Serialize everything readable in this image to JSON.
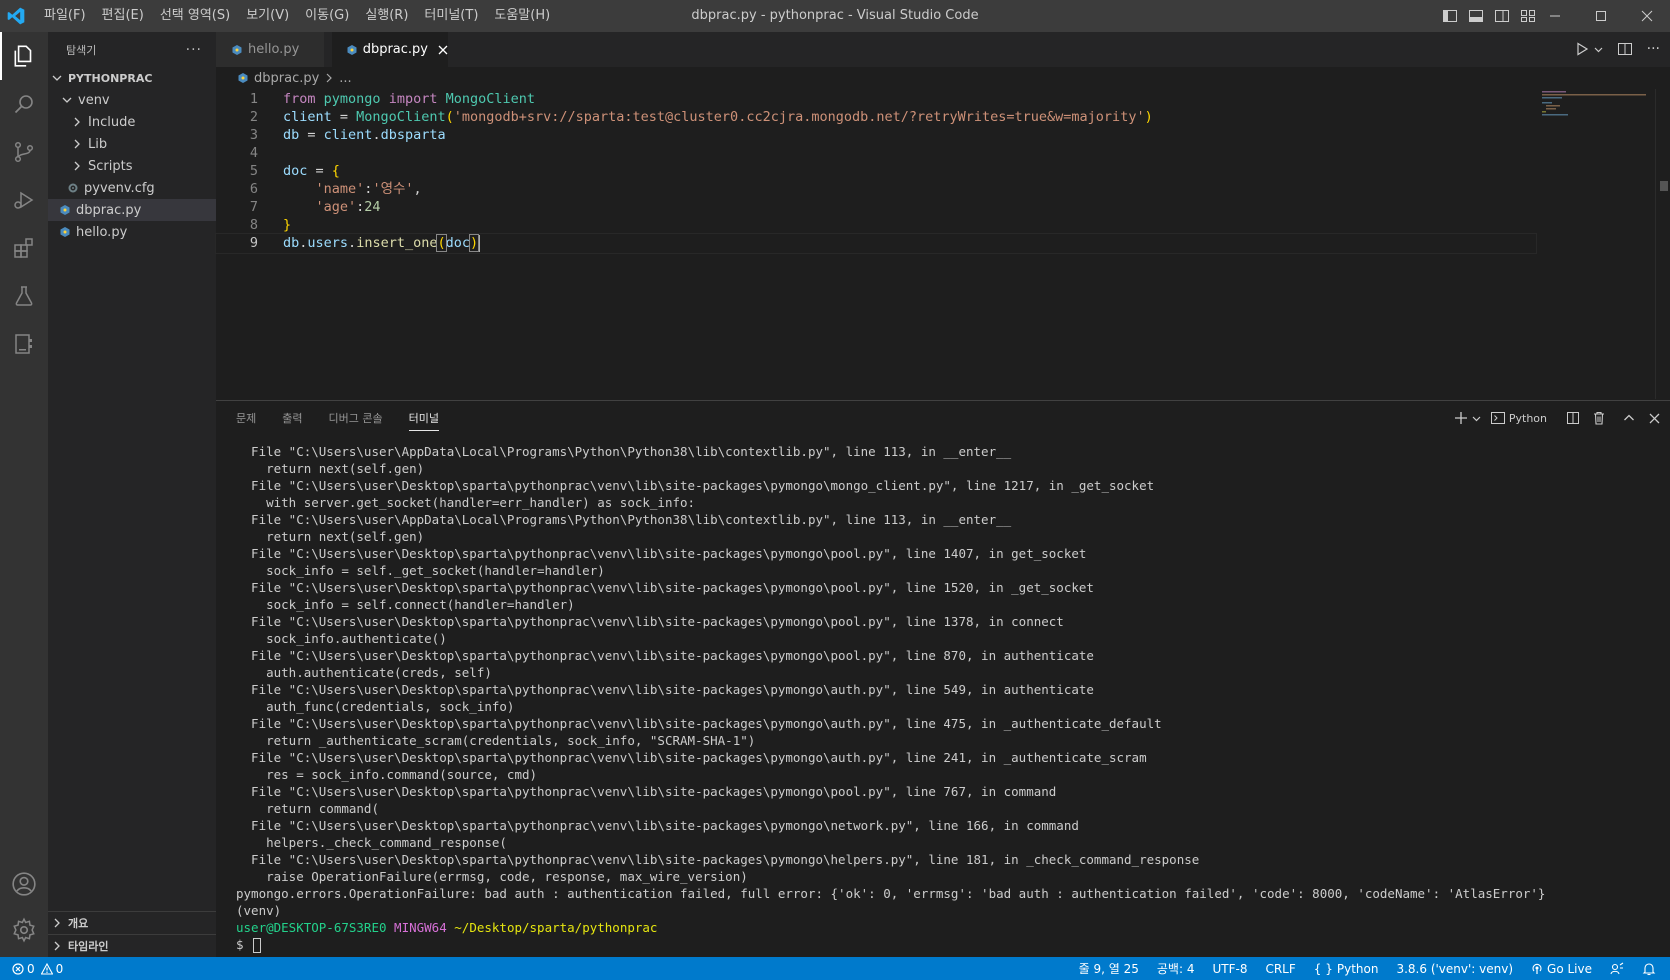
{
  "window": {
    "title": "dbprac.py - pythonprac - Visual Studio Code"
  },
  "menu": [
    "파일(F)",
    "편집(E)",
    "선택 영역(S)",
    "보기(V)",
    "이동(G)",
    "실행(R)",
    "터미널(T)",
    "도움말(H)"
  ],
  "sidebar": {
    "title": "탐색기",
    "root": "PYTHONPRAC",
    "tree": [
      {
        "label": "venv",
        "kind": "folder-open",
        "depth": 1
      },
      {
        "label": "Include",
        "kind": "folder",
        "depth": 2
      },
      {
        "label": "Lib",
        "kind": "folder",
        "depth": 2
      },
      {
        "label": "Scripts",
        "kind": "folder",
        "depth": 2
      },
      {
        "label": "pyvenv.cfg",
        "kind": "gear-file",
        "depth": 2
      },
      {
        "label": "dbprac.py",
        "kind": "python-file",
        "depth": 1,
        "selected": true
      },
      {
        "label": "hello.py",
        "kind": "python-file",
        "depth": 1
      }
    ],
    "outline": "개요",
    "timeline": "타임라인"
  },
  "tabs": [
    {
      "label": "hello.py",
      "active": false
    },
    {
      "label": "dbprac.py",
      "active": true
    }
  ],
  "breadcrumb": {
    "file": "dbprac.py",
    "rest": "..."
  },
  "editor": {
    "line_numbers": [
      "1",
      "2",
      "3",
      "4",
      "5",
      "6",
      "7",
      "8",
      "9"
    ],
    "current_line": 9
  },
  "panel": {
    "tabs": [
      "문제",
      "출력",
      "디버그 콘솔",
      "터미널"
    ],
    "active_tab": "터미널",
    "terminal_profile": "Python"
  },
  "terminal": {
    "lines": [
      "  File \"C:\\Users\\user\\AppData\\Local\\Programs\\Python\\Python38\\lib\\contextlib.py\", line 113, in __enter__",
      "    return next(self.gen)",
      "  File \"C:\\Users\\user\\Desktop\\sparta\\pythonprac\\venv\\lib\\site-packages\\pymongo\\mongo_client.py\", line 1217, in _get_socket",
      "    with server.get_socket(handler=err_handler) as sock_info:",
      "  File \"C:\\Users\\user\\AppData\\Local\\Programs\\Python\\Python38\\lib\\contextlib.py\", line 113, in __enter__",
      "    return next(self.gen)",
      "  File \"C:\\Users\\user\\Desktop\\sparta\\pythonprac\\venv\\lib\\site-packages\\pymongo\\pool.py\", line 1407, in get_socket",
      "    sock_info = self._get_socket(handler=handler)",
      "  File \"C:\\Users\\user\\Desktop\\sparta\\pythonprac\\venv\\lib\\site-packages\\pymongo\\pool.py\", line 1520, in _get_socket",
      "    sock_info = self.connect(handler=handler)",
      "  File \"C:\\Users\\user\\Desktop\\sparta\\pythonprac\\venv\\lib\\site-packages\\pymongo\\pool.py\", line 1378, in connect",
      "    sock_info.authenticate()",
      "  File \"C:\\Users\\user\\Desktop\\sparta\\pythonprac\\venv\\lib\\site-packages\\pymongo\\pool.py\", line 870, in authenticate",
      "    auth.authenticate(creds, self)",
      "  File \"C:\\Users\\user\\Desktop\\sparta\\pythonprac\\venv\\lib\\site-packages\\pymongo\\auth.py\", line 549, in authenticate",
      "    auth_func(credentials, sock_info)",
      "  File \"C:\\Users\\user\\Desktop\\sparta\\pythonprac\\venv\\lib\\site-packages\\pymongo\\auth.py\", line 475, in _authenticate_default",
      "    return _authenticate_scram(credentials, sock_info, \"SCRAM-SHA-1\")",
      "  File \"C:\\Users\\user\\Desktop\\sparta\\pythonprac\\venv\\lib\\site-packages\\pymongo\\auth.py\", line 241, in _authenticate_scram",
      "    res = sock_info.command(source, cmd)",
      "  File \"C:\\Users\\user\\Desktop\\sparta\\pythonprac\\venv\\lib\\site-packages\\pymongo\\pool.py\", line 767, in command",
      "    return command(",
      "  File \"C:\\Users\\user\\Desktop\\sparta\\pythonprac\\venv\\lib\\site-packages\\pymongo\\network.py\", line 166, in command",
      "    helpers._check_command_response(",
      "  File \"C:\\Users\\user\\Desktop\\sparta\\pythonprac\\venv\\lib\\site-packages\\pymongo\\helpers.py\", line 181, in _check_command_response",
      "    raise OperationFailure(errmsg, code, response, max_wire_version)",
      "pymongo.errors.OperationFailure: bad auth : authentication failed, full error: {'ok': 0, 'errmsg': 'bad auth : authentication failed', 'code': 8000, 'codeName': 'AtlasError'}",
      "(venv)"
    ],
    "prompt_user": "user@DESKTOP-67S3RE0",
    "prompt_shell": "MINGW64",
    "prompt_path": "~/Desktop/sparta/pythonprac",
    "prompt_symbol": "$"
  },
  "statusbar": {
    "errors": "0",
    "warnings": "0",
    "position": "줄 9, 열 25",
    "indent": "공백: 4",
    "encoding": "UTF-8",
    "eol": "CRLF",
    "language": "Python",
    "interpreter": "3.8.6 ('venv': venv)",
    "golive": "Go Live"
  },
  "colors": {
    "accent": "#007acc",
    "titlebar": "#3c3c3c",
    "sidebar": "#252526",
    "editor": "#1e1e1e"
  }
}
